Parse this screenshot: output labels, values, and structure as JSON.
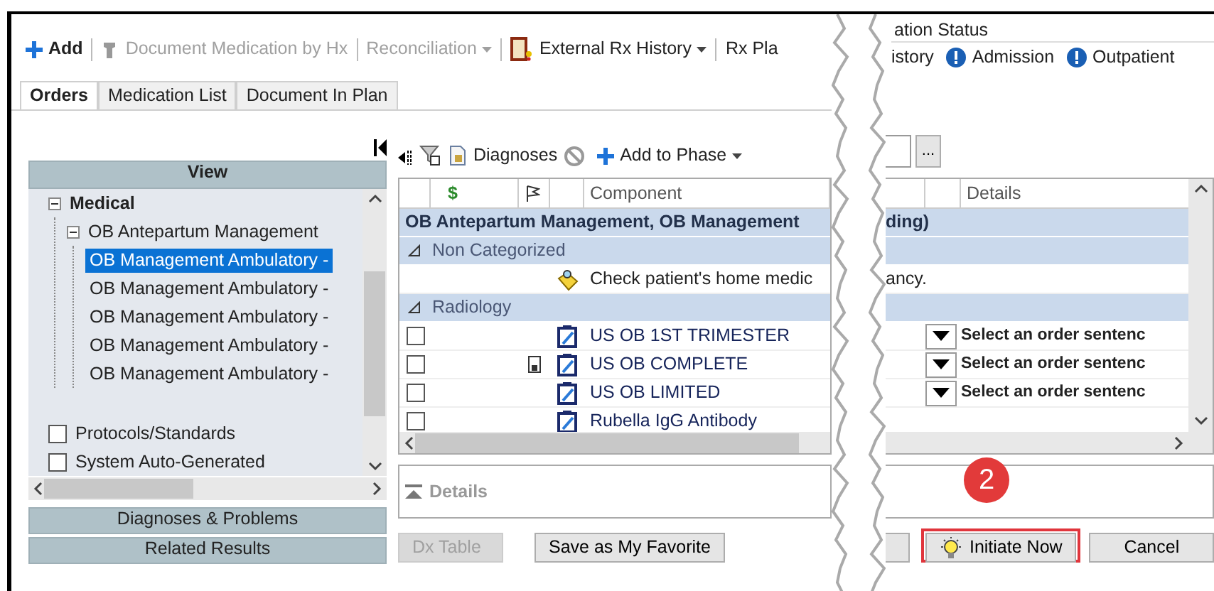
{
  "toolbar": [
    {
      "kind": "add",
      "label": "Add",
      "disabled": false
    },
    {
      "kind": "stamp",
      "label": "Document Medication by Hx",
      "disabled": true
    },
    {
      "kind": "menu",
      "label": "Reconciliation",
      "disabled": true
    },
    {
      "kind": "jar-menu",
      "label": "External Rx History",
      "disabled": false
    },
    {
      "kind": "plain",
      "label": "Rx Pla",
      "disabled": false
    }
  ],
  "status_group": {
    "title": "ation Status",
    "items": [
      {
        "kind": "plain",
        "label": "istory"
      },
      {
        "kind": "alert",
        "label": "Admission"
      },
      {
        "kind": "alert",
        "label": "Outpatient"
      }
    ]
  },
  "tabs": [
    {
      "label": "Orders",
      "selected": true
    },
    {
      "label": "Medication List",
      "selected": false
    },
    {
      "label": "Document In Plan",
      "selected": false
    }
  ],
  "sidebar": {
    "header": "View",
    "tree": [
      {
        "kind": "folder",
        "label": "Medical",
        "expanded": true,
        "children": [
          {
            "kind": "folder",
            "label": "OB Antepartum Management",
            "expanded": true,
            "children": [
              {
                "kind": "leaf",
                "label": "OB Management Ambulatory -",
                "selected": true
              },
              {
                "kind": "leaf",
                "label": "OB Management Ambulatory -",
                "selected": false
              },
              {
                "kind": "leaf",
                "label": "OB Management Ambulatory -",
                "selected": false
              },
              {
                "kind": "leaf",
                "label": "OB Management Ambulatory -",
                "selected": false
              },
              {
                "kind": "leaf",
                "label": "OB Management Ambulatory -",
                "selected": false
              }
            ]
          }
        ]
      },
      {
        "kind": "checkbox",
        "label": "Protocols/Standards",
        "checked": false
      },
      {
        "kind": "checkbox",
        "label": "System Auto-Generated",
        "checked": false
      }
    ],
    "sections": [
      {
        "label": "Diagnoses & Problems"
      },
      {
        "label": "Related Results"
      }
    ]
  },
  "orders_toolbar": {
    "diagnoses": "Diagnoses",
    "add_to_phase": "Add to Phase"
  },
  "more_button": "...",
  "table": {
    "columns": {
      "cost": "$",
      "component": "Component",
      "details": "Details"
    },
    "rows": [
      {
        "kind": "phase",
        "text": "OB Antepartum Management, OB Management",
        "text_end": "ding)"
      },
      {
        "kind": "category",
        "text": "Non Categorized",
        "expanded": true
      },
      {
        "kind": "note",
        "text": "Check patient's home medic",
        "text_end": "ancy."
      },
      {
        "kind": "category",
        "text": "Radiology",
        "expanded": true
      },
      {
        "kind": "order",
        "checked": false,
        "has_doc": false,
        "text": "US OB 1ST TRIMESTER",
        "details": "Select an order sentenc"
      },
      {
        "kind": "order",
        "checked": false,
        "has_doc": true,
        "text": "US OB COMPLETE",
        "details": "Select an order sentenc"
      },
      {
        "kind": "order",
        "checked": false,
        "has_doc": false,
        "text": "US OB LIMITED",
        "details": "Select an order sentenc"
      },
      {
        "kind": "order",
        "checked": false,
        "has_doc": false,
        "text": "Rubella IgG Antibody"
      }
    ]
  },
  "details_panel": {
    "label": "Details",
    "expanded": false
  },
  "footer": {
    "left": [
      {
        "kind": "plain",
        "label": "Dx Table",
        "disabled": true,
        "highlighted": false
      },
      {
        "kind": "plain",
        "label": "Save as My Favorite",
        "disabled": false,
        "highlighted": false
      }
    ],
    "right": [
      {
        "kind": "cut",
        "disabled": false,
        "highlighted": false
      },
      {
        "kind": "bulb",
        "label": "Initiate Now",
        "disabled": false,
        "highlighted": true
      },
      {
        "kind": "plain",
        "label": "Cancel",
        "disabled": false,
        "highlighted": false
      }
    ]
  },
  "callout": "2"
}
